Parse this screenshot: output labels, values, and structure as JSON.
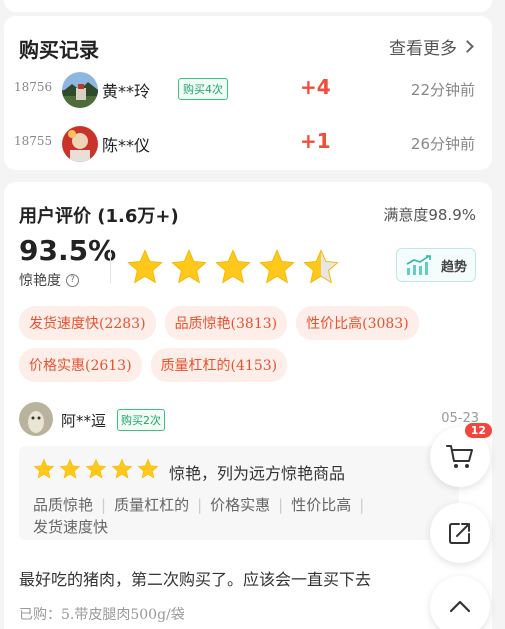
{
  "purchase": {
    "title": "购买记录",
    "more": "查看更多",
    "rows": [
      {
        "num": "18756",
        "name": "黄**玲",
        "badge": "购买4次",
        "plus": "+4",
        "time": "22分钟前"
      },
      {
        "num": "18755",
        "name": "陈**仪",
        "badge": "",
        "plus": "+1",
        "time": "26分钟前"
      }
    ]
  },
  "review": {
    "title": "用户评价 (1.6万+)",
    "satisfaction": "满意度98.9%",
    "big_percent": "93.5%",
    "percent_label": "惊艳度",
    "rating_stars": 4.5,
    "trend_label": "趋势",
    "tags": [
      "发货速度快(2283)",
      "品质惊艳(3813)",
      "性价比高(3083)",
      "价格实惠(2613)",
      "质量杠杠的(4153)"
    ],
    "item": {
      "user": "阿**逗",
      "badge": "购买2次",
      "date": "05-23",
      "stars": 5,
      "short": "惊艳，列为远方惊艳商品",
      "aspects": [
        "品质惊艳",
        "质量杠杠的",
        "价格实惠",
        "性价比高",
        "发货速度快"
      ],
      "text": "最好吃的猪肉，第二次购买了。应该会一直买下去",
      "bought": "已购：5.带皮腿肉500g/袋"
    }
  },
  "floating": {
    "cart_count": "12"
  },
  "colors": {
    "accent_red": "#f24d3a",
    "star_yellow": "#ffc81a",
    "tag_bg": "#fdeee9",
    "tag_text": "#e8532f",
    "badge_green": "#1ea56a"
  }
}
